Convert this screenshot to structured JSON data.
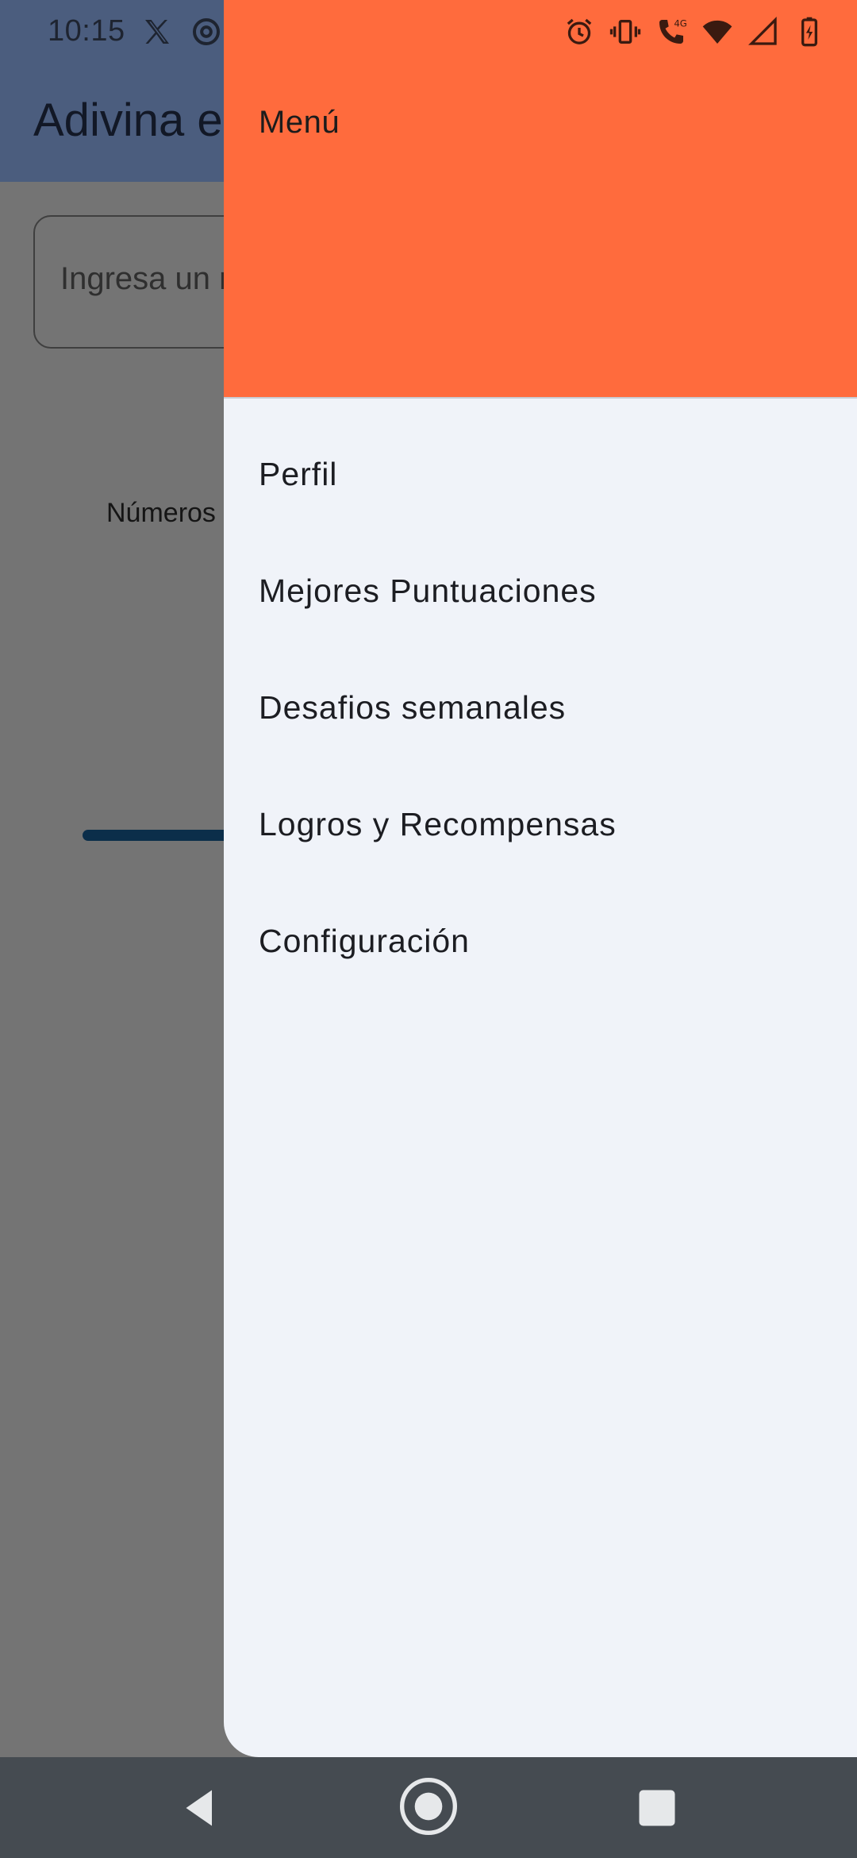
{
  "status_bar": {
    "time": "10:15"
  },
  "app": {
    "title": "Adivina el número",
    "input_placeholder": "Ingresa un número",
    "numbers_label": "Números"
  },
  "drawer": {
    "title": "Menú",
    "header_color": "#ff6b3d",
    "items": [
      {
        "label": "Perfil"
      },
      {
        "label": "Mejores Puntuaciones"
      },
      {
        "label": "Desafios semanales"
      },
      {
        "label": "Logros y Recompensas"
      },
      {
        "label": "Configuración"
      }
    ]
  },
  "icons": {
    "status_left": [
      "x-icon",
      "at-sign-icon"
    ],
    "status_right": [
      "alarm-icon",
      "vibrate-icon",
      "call-4g-icon",
      "wifi-icon",
      "signal-icon",
      "battery-charging-icon"
    ],
    "nav": [
      "back-icon",
      "home-icon",
      "recents-icon"
    ]
  }
}
